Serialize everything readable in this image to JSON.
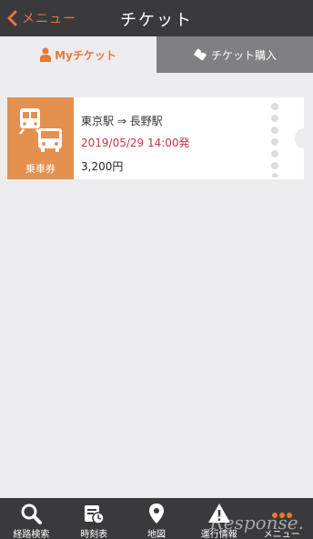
{
  "header": {
    "back_label": "メニュー",
    "title": "チケット"
  },
  "tabs": {
    "my_ticket": "Myチケット",
    "purchase": "チケット購入"
  },
  "ticket": {
    "type": "乗車券",
    "route": "東京駅 ⇒ 長野駅",
    "departure": "2019/05/29 14:00発",
    "price": "3,200円"
  },
  "bottom_nav": [
    {
      "label": "経路検索",
      "icon": "search-icon"
    },
    {
      "label": "時刻表",
      "icon": "timetable-icon"
    },
    {
      "label": "地図",
      "icon": "map-pin-icon"
    },
    {
      "label": "運行情報",
      "icon": "warning-icon"
    },
    {
      "label": "メニュー",
      "icon": "more-icon"
    }
  ],
  "watermark": "Response.",
  "colors": {
    "accent": "#e8763a",
    "header": "#3a3a3c",
    "departure": "#d03145",
    "ticket_side": "#e4904f"
  }
}
